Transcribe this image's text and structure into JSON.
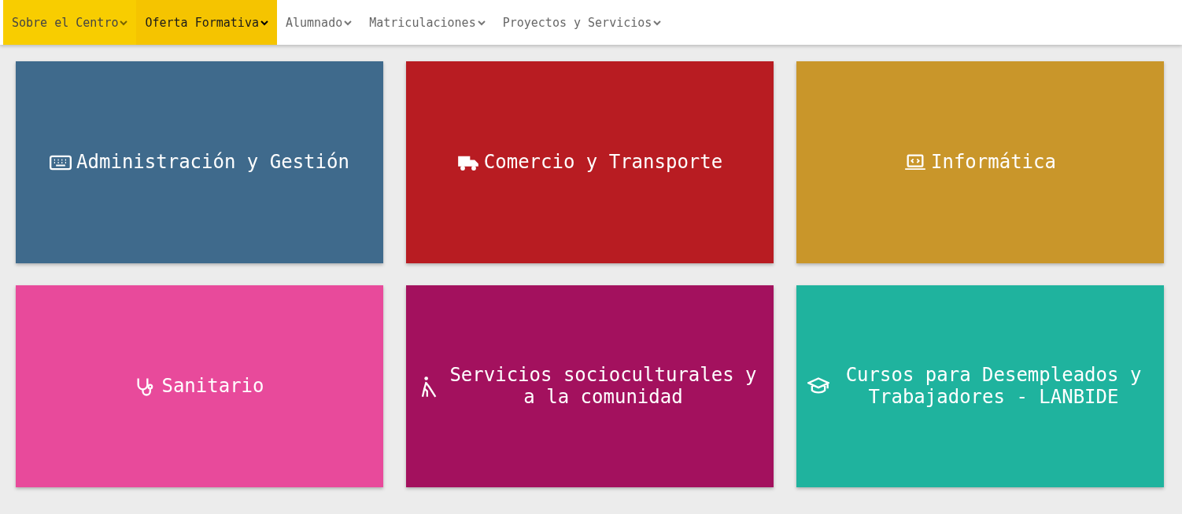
{
  "nav": [
    {
      "label": "Sobre el Centro",
      "highlighted": true,
      "selected": false
    },
    {
      "label": "Oferta Formativa",
      "highlighted": true,
      "selected": true
    },
    {
      "label": "Alumnado",
      "highlighted": false,
      "selected": false
    },
    {
      "label": "Matriculaciones",
      "highlighted": false,
      "selected": false
    },
    {
      "label": "Proyectos y Servicios",
      "highlighted": false,
      "selected": false
    }
  ],
  "cards": [
    {
      "title": "Administración y Gestión",
      "kind": "keyboard",
      "color": "#3f6a8c"
    },
    {
      "title": "Comercio y Transporte",
      "kind": "truck",
      "color": "#b81c22"
    },
    {
      "title": "Informática",
      "kind": "laptop",
      "color": "#c9962a"
    },
    {
      "title": "Sanitario",
      "kind": "stethoscope",
      "color": "#e84a9b"
    },
    {
      "title": "Servicios socioculturales y a la comunidad",
      "kind": "person",
      "color": "#a3115e"
    },
    {
      "title": "Cursos para Desempleados y Trabajadores - LANBIDE",
      "kind": "cap",
      "color": "#1fb39e"
    }
  ]
}
